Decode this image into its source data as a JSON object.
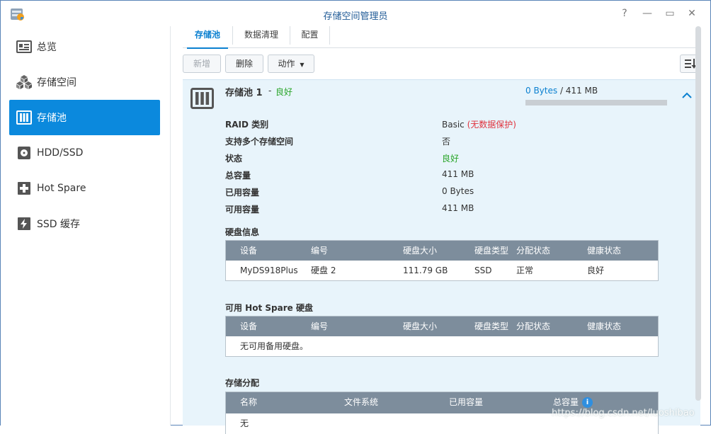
{
  "window": {
    "title": "存储空间管理员",
    "controls": {
      "help": "?",
      "minimize": "—",
      "maximize": "▭",
      "close": "✕"
    }
  },
  "sidebar": {
    "items": [
      {
        "label": "总览",
        "icon": "overview-icon"
      },
      {
        "label": "存储空间",
        "icon": "volume-cubes-icon"
      },
      {
        "label": "存储池",
        "icon": "storage-pool-icon",
        "active": true
      },
      {
        "label": "HDD/SSD",
        "icon": "disk-icon"
      },
      {
        "label": "Hot Spare",
        "icon": "hot-spare-plus-icon"
      },
      {
        "label": "SSD 缓存",
        "icon": "ssd-cache-bolt-icon"
      }
    ]
  },
  "tabs": [
    {
      "label": "存储池",
      "active": true
    },
    {
      "label": "数据清理"
    },
    {
      "label": "配置"
    }
  ],
  "toolbar": {
    "add": "新增",
    "delete": "删除",
    "action": "动作",
    "sort_icon": "sort-list-icon"
  },
  "pool": {
    "name": "存储池 1",
    "separator": "-",
    "status": "良好",
    "used_text": "0 Bytes",
    "total_text": " / 411 MB",
    "usage_fraction": 0.0,
    "details": [
      {
        "label": "RAID 类别",
        "value": "Basic",
        "note": "(无数据保护)"
      },
      {
        "label": "支持多个存储空间",
        "value": "否"
      },
      {
        "label": "状态",
        "value": "良好"
      },
      {
        "label": "总容量",
        "value": "411 MB"
      },
      {
        "label": "已用容量",
        "value": "0 Bytes"
      },
      {
        "label": "可用容量",
        "value": "411 MB"
      }
    ]
  },
  "disk_info": {
    "title": "硬盘信息",
    "columns": [
      "设备",
      "编号",
      "硬盘大小",
      "硬盘类型",
      "分配状态",
      "健康状态"
    ],
    "rows": [
      [
        "MyDS918Plus",
        "硬盘 2",
        "111.79 GB",
        "SSD",
        "正常",
        "良好"
      ]
    ]
  },
  "hot_spare": {
    "title": "可用 Hot Spare 硬盘",
    "columns": [
      "设备",
      "编号",
      "硬盘大小",
      "硬盘类型",
      "分配状态",
      "健康状态"
    ],
    "empty_text": "无可用备用硬盘。"
  },
  "allocation": {
    "title": "存储分配",
    "columns": [
      "名称",
      "文件系统",
      "已用容量",
      "总容量"
    ],
    "first_row": "无"
  },
  "watermark": "https://blog.csdn.net/luoshibao",
  "colors": {
    "accent": "#0b89dd",
    "good": "#2aa52a",
    "warning": "#e0333d",
    "header": "#7d8d9c"
  }
}
